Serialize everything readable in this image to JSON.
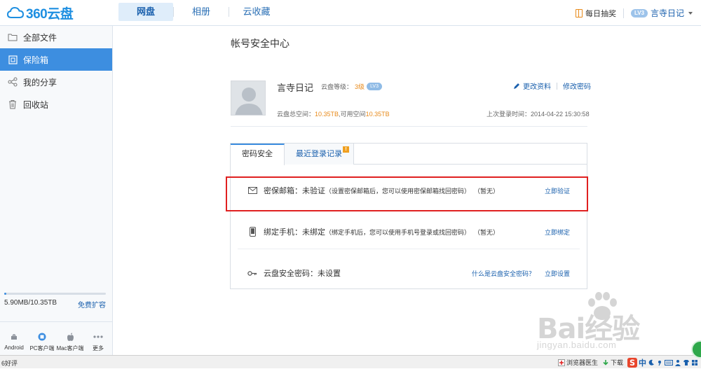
{
  "app": {
    "logo_text": "360云盘",
    "nav": [
      "网盘",
      "相册",
      "云收藏"
    ],
    "lottery": "每日抽奖",
    "user_badge": "LV3",
    "user_name": "言寺日记"
  },
  "sidebar": {
    "items": [
      {
        "label": "全部文件",
        "icon": "folder-icon"
      },
      {
        "label": "保险箱",
        "icon": "safe-icon"
      },
      {
        "label": "我的分享",
        "icon": "share-icon"
      },
      {
        "label": "回收站",
        "icon": "trash-icon"
      }
    ],
    "usage_text": "5.90MB/10.35TB",
    "usage_fraction": 0.0001,
    "expand_link": "免费扩容",
    "clients": [
      "Android",
      "PC客户端",
      "Mac客户端",
      "更多"
    ]
  },
  "main": {
    "title": "帐号安全中心",
    "profile": {
      "name": "言寺日记",
      "level_label": "云盘等级：",
      "level_value": "3级",
      "level_badge": "LV3",
      "edit_profile": "更改资料",
      "change_password": "修改密码",
      "space_total_label": "云盘总空间：",
      "space_total": "10.35TB",
      "space_avail_label": ",可用空间",
      "space_avail": "10.35TB",
      "last_login": "上次登录时间：2014-04-22 15:30:58"
    },
    "tabs": [
      "密码安全",
      "最近登录记录"
    ],
    "tab_alert": "!",
    "rows": [
      {
        "icon": "mail-icon",
        "label": "密保邮箱：未验证",
        "hint": "（设置密保邮箱后，您可以使用密保邮箱找回密码）",
        "status": "（暂无）",
        "action": "立即验证"
      },
      {
        "icon": "phone-icon",
        "label": "绑定手机：未绑定",
        "hint": "（绑定手机后，您可以使用手机号登录或找回密码）",
        "status": "（暂无）",
        "action": "立即绑定"
      },
      {
        "icon": "key-icon",
        "label": "云盘安全密码：未设置",
        "help": "什么是云盘安全密码？",
        "action": "立即设置"
      }
    ]
  },
  "watermark": {
    "main": "Bai经验",
    "sub": "jingyan.baidu.com"
  },
  "statusbar": {
    "left": "6好评",
    "browser_doctor": "浏览器医生",
    "download": "下载",
    "ime": "中"
  }
}
